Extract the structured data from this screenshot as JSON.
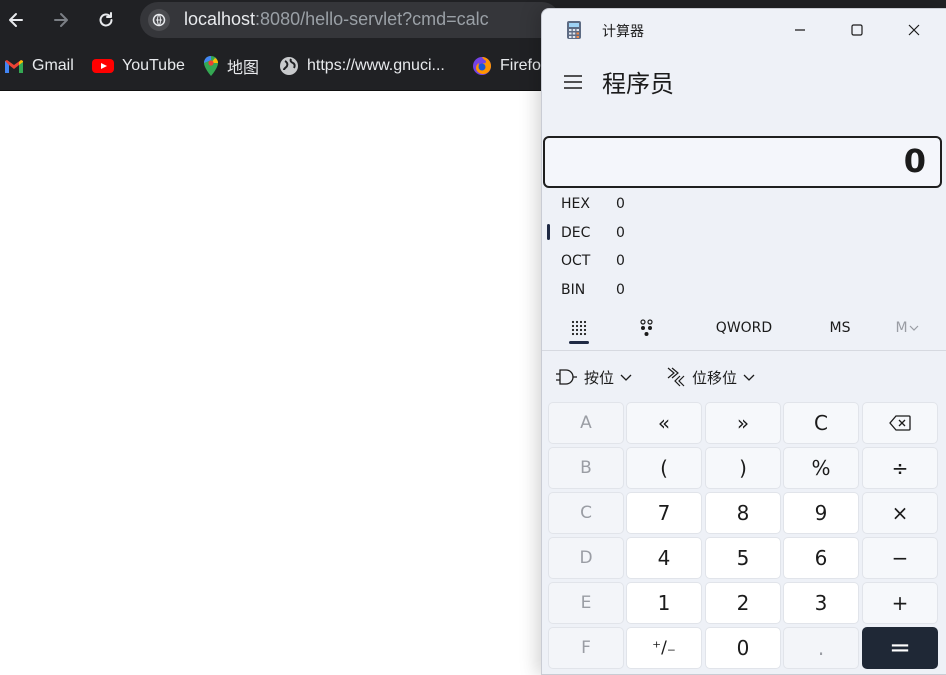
{
  "browser": {
    "url_host": "localhost",
    "url_path": ":8080/hello-servlet?cmd=calc",
    "bookmarks": [
      {
        "label": "Gmail",
        "icon": "gmail-icon"
      },
      {
        "label": "YouTube",
        "icon": "youtube-icon"
      },
      {
        "label": "地图",
        "icon": "maps-icon"
      },
      {
        "label": "https://www.gnuci...",
        "icon": "globe-icon"
      },
      {
        "label": "Firefox",
        "icon": "firefox-icon"
      }
    ]
  },
  "calculator": {
    "title": "计算器",
    "mode": "程序员",
    "display": "0",
    "radix": [
      {
        "label": "HEX",
        "value": "0"
      },
      {
        "label": "DEC",
        "value": "0"
      },
      {
        "label": "OCT",
        "value": "0"
      },
      {
        "label": "BIN",
        "value": "0"
      }
    ],
    "toolbar": {
      "word_size": "QWORD",
      "ms": "MS",
      "mv": "M"
    },
    "dropdowns": {
      "bitwise": "按位",
      "bitshift": "位移位"
    },
    "keys": [
      [
        "A",
        "«",
        "»",
        "C",
        "⌫"
      ],
      [
        "B",
        "(",
        ")",
        "%",
        "÷"
      ],
      [
        "C",
        "7",
        "8",
        "9",
        "×"
      ],
      [
        "D",
        "4",
        "5",
        "6",
        "−"
      ],
      [
        "E",
        "1",
        "2",
        "3",
        "+"
      ],
      [
        "F",
        "⁺/₋",
        "0",
        ".",
        "="
      ]
    ],
    "colors": {
      "accent": "#1f2836",
      "panel": "#eef1f7"
    }
  }
}
